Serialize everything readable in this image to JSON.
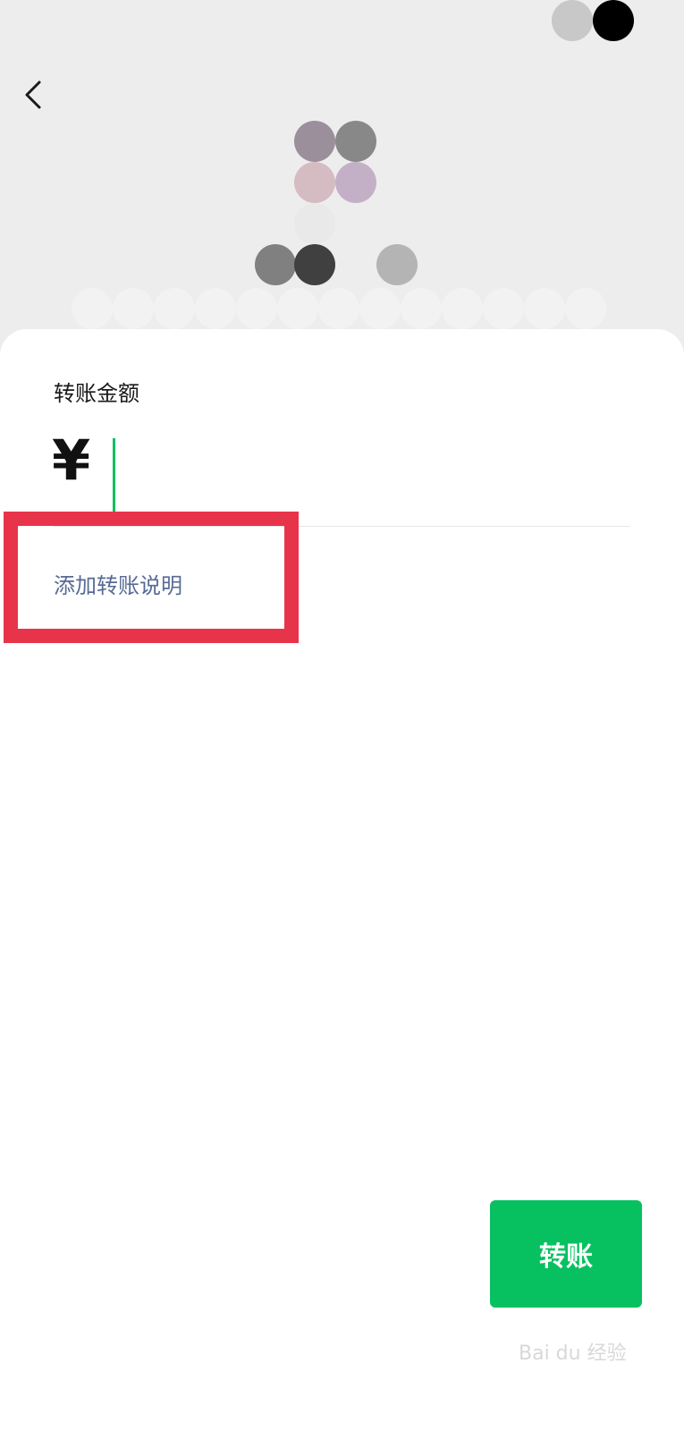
{
  "form": {
    "amount_label": "转账金额",
    "currency_symbol": "¥",
    "amount_value": "",
    "add_note_link": "添加转账说明"
  },
  "actions": {
    "transfer_button": "转账"
  },
  "watermark": {
    "text": "Bai du 经验"
  },
  "colors": {
    "accent_green": "#07c160",
    "link_blue": "#576b95",
    "highlight_red": "#e8344a",
    "header_bg": "#ededed"
  }
}
